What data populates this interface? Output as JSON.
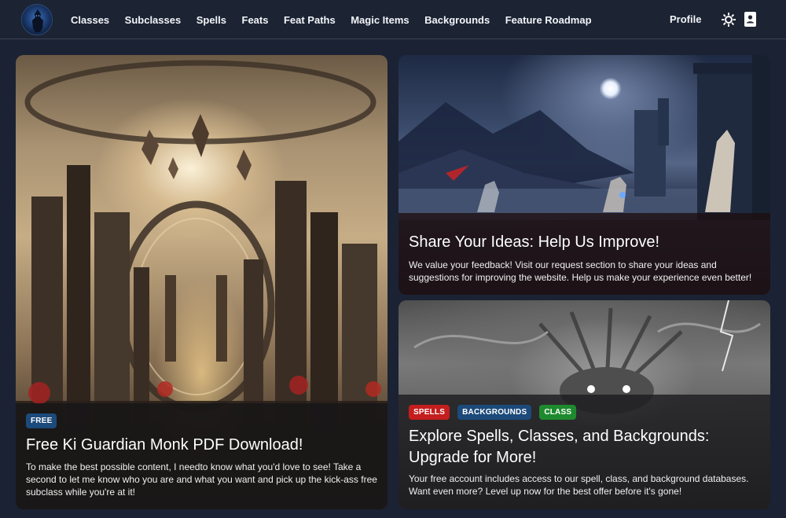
{
  "nav": {
    "items": [
      "Classes",
      "Subclasses",
      "Spells",
      "Feats",
      "Feat Paths",
      "Magic Items",
      "Backgrounds",
      "Feature Roadmap"
    ],
    "profile_label": "Profile"
  },
  "icons": {
    "logo": "hooded-warrior-logo",
    "theme": "sun-icon",
    "account": "account-card-icon"
  },
  "colors": {
    "background": "#1b2233",
    "badge_free": "#1c4a7a",
    "badge_spells": "#c41e1e",
    "badge_backgrounds": "#1c4a7a",
    "badge_class": "#1e8a2e"
  },
  "cards": {
    "monk": {
      "badges": [
        "FREE"
      ],
      "title": "Free Ki Guardian Monk PDF Download!",
      "description": "To make the best possible content, I needto know what you'd love to see! Take a second to let me know who you are and what you want and pick up the kick-ass free subclass while you're at it!"
    },
    "ideas": {
      "title": "Share Your Ideas: Help Us Improve!",
      "description": "We value your feedback! Visit our request section to share your ideas and suggestions for improving the website. Help us make your experience even better!"
    },
    "explore": {
      "badges": [
        "SPELLS",
        "BACKGROUNDS",
        "CLASS"
      ],
      "title": "Explore Spells, Classes, and Backgrounds: Upgrade for More!",
      "description": "Your free account includes access to our spell, class, and background databases. Want even more? Level up now for the best offer before it's gone!"
    }
  }
}
